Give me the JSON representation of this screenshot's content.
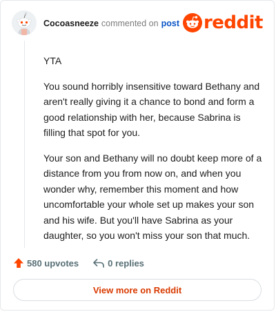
{
  "header": {
    "username": "Cocoasneeze",
    "action": "commented on",
    "target": "post",
    "logo_text": "reddit",
    "brand_color": "#ff4500"
  },
  "comment": {
    "paragraphs": [
      "YTA",
      "You sound horribly insensitive toward Bethany and aren't really giving it a chance to bond and form a good relationship with her, because Sabrina is filling that spot for you.",
      "Your son and Bethany will no doubt keep more of a distance from you from now on, and when you wonder why, remember this moment and how uncomfortable your whole set up makes your son and his wife. But you'll have Sabrina as your daughter, so you won't miss your son that much."
    ]
  },
  "footer": {
    "upvotes": "580 upvotes",
    "replies": "0 replies",
    "upvote_icon": "upvote-arrow-icon",
    "reply_icon": "reply-arrow-icon"
  },
  "cta": {
    "label": "View more on Reddit"
  }
}
